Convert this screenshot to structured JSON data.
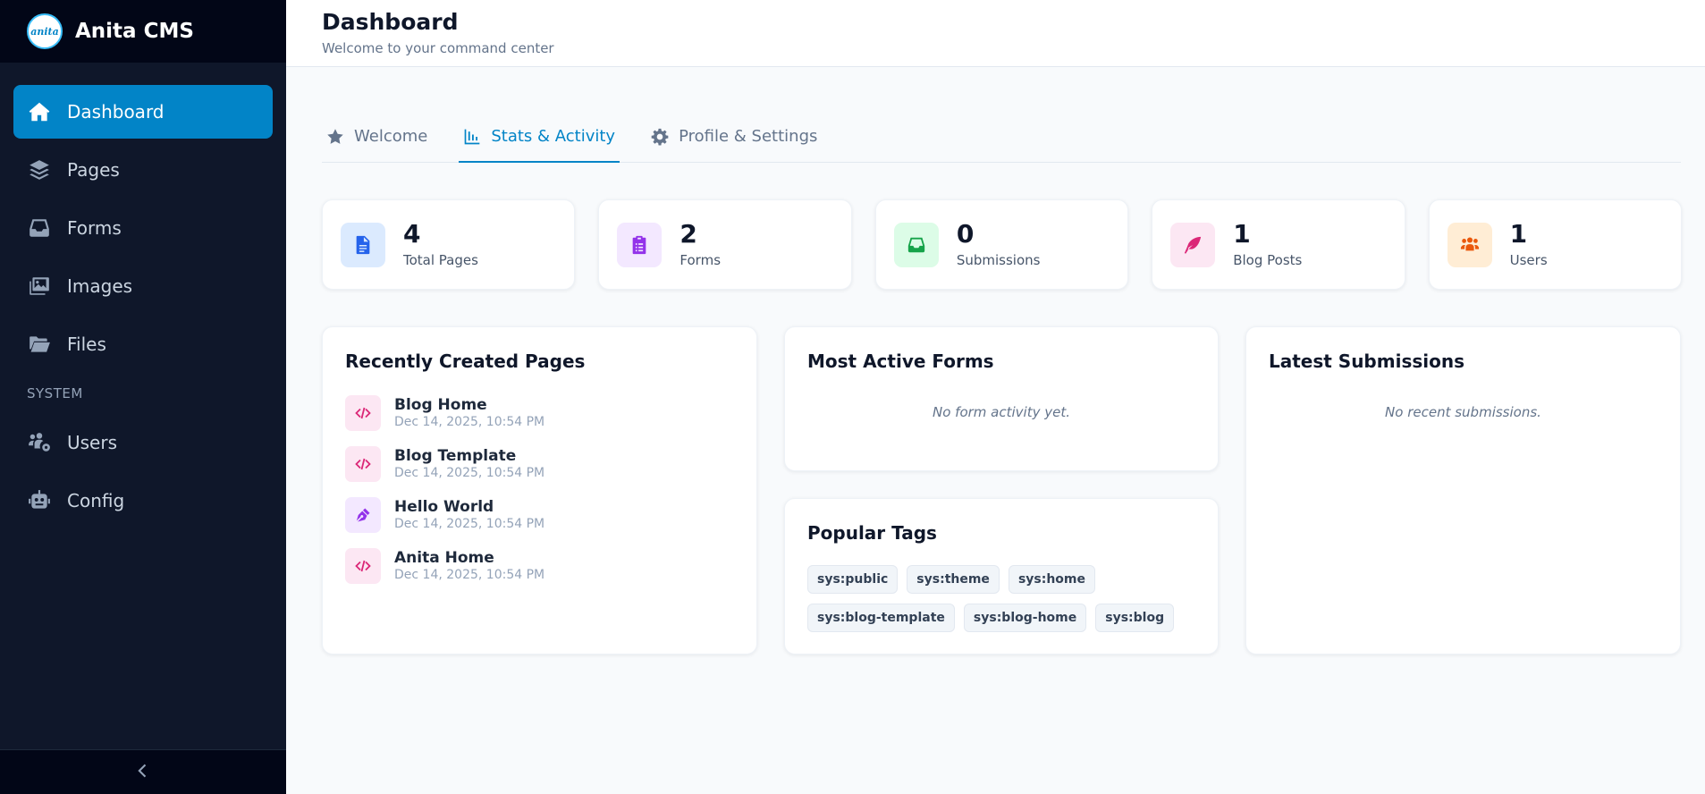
{
  "brand": {
    "logo_text": "anita",
    "name": "Anita CMS"
  },
  "sidebar": {
    "items": [
      {
        "label": "Dashboard",
        "icon": "home-icon",
        "active": true
      },
      {
        "label": "Pages",
        "icon": "layers-icon"
      },
      {
        "label": "Forms",
        "icon": "inbox-icon"
      },
      {
        "label": "Images",
        "icon": "images-icon"
      },
      {
        "label": "Files",
        "icon": "folder-open-icon"
      }
    ],
    "section_label": "SYSTEM",
    "system_items": [
      {
        "label": "Users",
        "icon": "users-gear-icon"
      },
      {
        "label": "Config",
        "icon": "robot-icon"
      }
    ],
    "collapse_icon": "chevron-left-icon"
  },
  "header": {
    "title": "Dashboard",
    "subtitle": "Welcome to your command center"
  },
  "tabs": [
    {
      "label": "Welcome",
      "icon": "star-icon"
    },
    {
      "label": "Stats & Activity",
      "icon": "chart-icon",
      "active": true
    },
    {
      "label": "Profile & Settings",
      "icon": "gear-icon"
    }
  ],
  "stats": [
    {
      "value": "4",
      "label": "Total Pages",
      "icon": "file-icon",
      "color": "#2563eb",
      "bg": "#dbeafe"
    },
    {
      "value": "2",
      "label": "Forms",
      "icon": "clipboard-list-icon",
      "color": "#9333ea",
      "bg": "#f3e8ff"
    },
    {
      "value": "0",
      "label": "Submissions",
      "icon": "inbox-icon",
      "color": "#16a34a",
      "bg": "#dcfce7"
    },
    {
      "value": "1",
      "label": "Blog Posts",
      "icon": "feather-icon",
      "color": "#db2777",
      "bg": "#fce7f3"
    },
    {
      "value": "1",
      "label": "Users",
      "icon": "users-icon",
      "color": "#ea580c",
      "bg": "#ffedd5"
    }
  ],
  "recent_pages": {
    "title": "Recently Created Pages",
    "items": [
      {
        "title": "Blog Home",
        "date": "Dec 14, 2025, 10:54 PM",
        "icon": "code-icon"
      },
      {
        "title": "Blog Template",
        "date": "Dec 14, 2025, 10:54 PM",
        "icon": "code-icon"
      },
      {
        "title": "Hello World",
        "date": "Dec 14, 2025, 10:54 PM",
        "icon": "pen-nib-icon"
      },
      {
        "title": "Anita Home",
        "date": "Dec 14, 2025, 10:54 PM",
        "icon": "code-icon"
      }
    ]
  },
  "active_forms": {
    "title": "Most Active Forms",
    "empty": "No form activity yet."
  },
  "popular_tags": {
    "title": "Popular Tags",
    "tags": [
      "sys:public",
      "sys:theme",
      "sys:home",
      "sys:blog-template",
      "sys:blog-home",
      "sys:blog"
    ]
  },
  "latest_submissions": {
    "title": "Latest Submissions",
    "empty": "No recent submissions."
  }
}
